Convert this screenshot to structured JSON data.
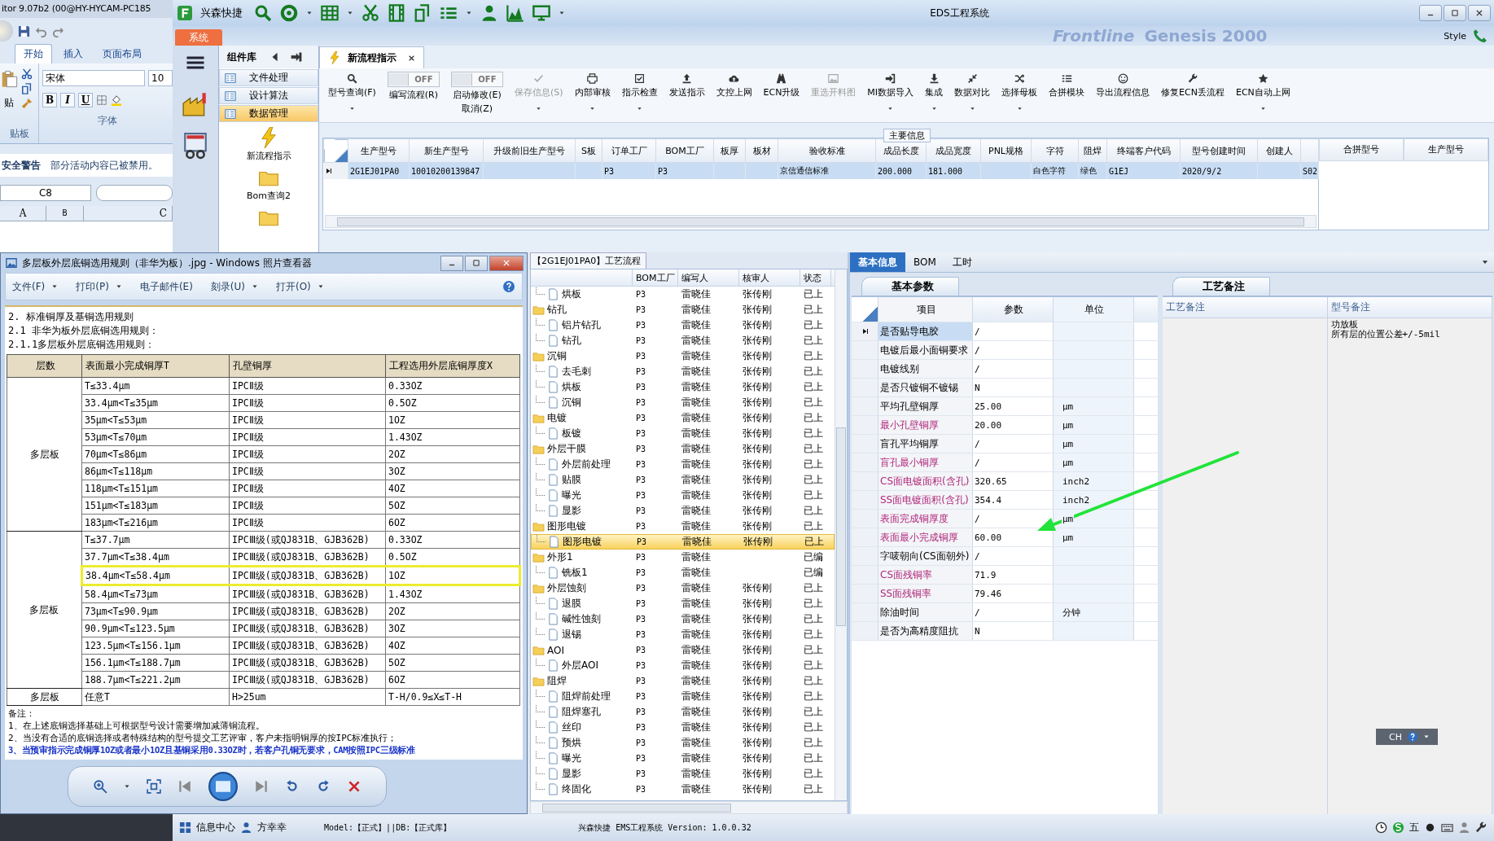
{
  "excel": {
    "window_title": "itor 9.07b2 (00@HY-HYCAM-PC185",
    "ribbon_tabs": [
      {
        "label": "开始",
        "selected": true
      },
      {
        "label": "插入",
        "selected": false
      },
      {
        "label": "页面布局",
        "selected": false
      }
    ],
    "paste_label": "贴",
    "font_name": "宋体",
    "font_size": "10",
    "format_buttons": [
      "B",
      "I",
      "U"
    ],
    "groups": [
      "贴板",
      "字体"
    ],
    "security_bar": {
      "title": "安全警告",
      "message": "部分活动内容已被禁用。"
    },
    "name_box": "C8",
    "columns": [
      "A",
      "B",
      "C"
    ]
  },
  "app": {
    "brand": "兴森快捷",
    "title": "EDS工程系统",
    "menu_tab": "系统",
    "background_texts": [
      "Frontline",
      "Genesis 2000"
    ],
    "style_menu": "Style"
  },
  "component_library": {
    "title": "组件库",
    "sections": [
      {
        "label": "文件处理",
        "selected": false
      },
      {
        "label": "设计算法",
        "selected": false
      },
      {
        "label": "数据管理",
        "selected": true
      }
    ],
    "items": [
      {
        "label": "新流程指示",
        "kind": "flash"
      },
      {
        "label": "Bom查询2",
        "kind": "folder"
      },
      {
        "kind": "folder"
      }
    ]
  },
  "document_tab": {
    "label": "新流程指示"
  },
  "toolbar": [
    {
      "label": "型号查询(F)",
      "kind": "button",
      "disabled": false,
      "dropdown": true
    },
    {
      "label": "编写流程(R)",
      "kind": "toggle",
      "state_text": "OFF",
      "on": false
    },
    {
      "label": "启动修改(E)",
      "second_line": "取消(Z)",
      "kind": "toggle",
      "state_text": "OFF",
      "on": false
    },
    {
      "label": "保存信息(S)",
      "kind": "button",
      "disabled": true,
      "dropdown": true
    },
    {
      "label": "内部审核",
      "kind": "button",
      "disabled": false,
      "dropdown": true
    },
    {
      "label": "指示检查",
      "kind": "button",
      "disabled": false,
      "dropdown": true
    },
    {
      "label": "发送指示",
      "kind": "button",
      "disabled": false,
      "dropdown": false
    },
    {
      "label": "文控上网",
      "kind": "button",
      "disabled": false,
      "dropdown": false
    },
    {
      "label": "ECN升级",
      "kind": "button",
      "disabled": false,
      "dropdown": false
    },
    {
      "label": "重选开料图",
      "kind": "button",
      "disabled": true,
      "dropdown": false
    },
    {
      "label": "MI数据导入",
      "kind": "button",
      "disabled": false,
      "dropdown": true
    },
    {
      "label": "集成",
      "kind": "button",
      "disabled": false,
      "dropdown": true
    },
    {
      "label": "数据对比",
      "kind": "button",
      "disabled": false,
      "dropdown": true
    },
    {
      "label": "选择母板",
      "kind": "button",
      "disabled": false,
      "dropdown": true
    },
    {
      "label": "合拼模块",
      "kind": "button",
      "disabled": false,
      "dropdown": false
    },
    {
      "label": "导出流程信息",
      "kind": "button",
      "disabled": false,
      "dropdown": false
    },
    {
      "label": "修复ECN丢流程",
      "kind": "button",
      "disabled": false,
      "dropdown": false
    },
    {
      "label": "ECN自动上网",
      "kind": "button",
      "disabled": false,
      "dropdown": true
    }
  ],
  "main_info": {
    "title": "主要信息",
    "columns": [
      "生产型号",
      "新生产型号",
      "升级前旧生产型号",
      "S板",
      "订单工厂",
      "BOM工厂",
      "板厚",
      "板材",
      "验收标准",
      "成品长度",
      "成品宽度",
      "PNL规格",
      "字符",
      "阻焊",
      "终端客户代码",
      "型号创建时间",
      "创建人"
    ],
    "rows": [
      {
        "selected": true,
        "cells": [
          "2G1EJ01PA0",
          "10010200139847",
          null,
          null,
          "P3",
          "P3",
          null,
          null,
          "京信通信标准",
          "200.000",
          "181.000",
          null,
          "白色字符",
          "绿色",
          "G1EJ",
          "2020/9/2",
          null,
          "S02"
        ]
      }
    ],
    "side_columns": [
      "合拼型号",
      "生产型号"
    ]
  },
  "process_flow": {
    "title": "【2G1EJ01PA0】工艺流程",
    "columns": [
      "BOM工厂",
      "编写人",
      "核审人",
      "状态"
    ],
    "rows": [
      {
        "name": "烘板",
        "kind": "step",
        "bom": "P3",
        "writer": "雷晓佳",
        "reviewer": "张传刚",
        "status": "已上",
        "selected": false
      },
      {
        "name": "钻孔",
        "kind": "folder",
        "bom": "P3",
        "writer": "雷晓佳",
        "reviewer": "张传刚",
        "status": "已上",
        "selected": false,
        "children": [
          {
            "name": "铝片钻孔",
            "kind": "step",
            "bom": "P3",
            "writer": "雷晓佳",
            "reviewer": "张传刚",
            "status": "已上",
            "selected": false
          },
          {
            "name": "钻孔",
            "kind": "step",
            "bom": "P3",
            "writer": "雷晓佳",
            "reviewer": "张传刚",
            "status": "已上",
            "selected": false
          }
        ]
      },
      {
        "name": "沉铜",
        "kind": "folder",
        "bom": "P3",
        "writer": "雷晓佳",
        "reviewer": "张传刚",
        "status": "已上",
        "selected": false,
        "children": [
          {
            "name": "去毛刺",
            "kind": "step",
            "bom": "P3",
            "writer": "雷晓佳",
            "reviewer": "张传刚",
            "status": "已上",
            "selected": false
          },
          {
            "name": "烘板",
            "kind": "step",
            "bom": "P3",
            "writer": "雷晓佳",
            "reviewer": "张传刚",
            "status": "已上",
            "selected": false
          },
          {
            "name": "沉铜",
            "kind": "step",
            "bom": "P3",
            "writer": "雷晓佳",
            "reviewer": "张传刚",
            "status": "已上",
            "selected": false
          }
        ]
      },
      {
        "name": "电镀",
        "kind": "folder",
        "bom": "P3",
        "writer": "雷晓佳",
        "reviewer": "张传刚",
        "status": "已上",
        "selected": false,
        "children": [
          {
            "name": "板镀",
            "kind": "step",
            "bom": "P3",
            "writer": "雷晓佳",
            "reviewer": "张传刚",
            "status": "已上",
            "selected": false
          }
        ]
      },
      {
        "name": "外层干膜",
        "kind": "folder",
        "bom": "P3",
        "writer": "雷晓佳",
        "reviewer": "张传刚",
        "status": "已上",
        "selected": false,
        "children": [
          {
            "name": "外层前处理",
            "kind": "step",
            "bom": "P3",
            "writer": "雷晓佳",
            "reviewer": "张传刚",
            "status": "已上",
            "selected": false
          },
          {
            "name": "贴膜",
            "kind": "step",
            "bom": "P3",
            "writer": "雷晓佳",
            "reviewer": "张传刚",
            "status": "已上",
            "selected": false
          },
          {
            "name": "曝光",
            "kind": "step",
            "bom": "P3",
            "writer": "雷晓佳",
            "reviewer": "张传刚",
            "status": "已上",
            "selected": false
          },
          {
            "name": "显影",
            "kind": "step",
            "bom": "P3",
            "writer": "雷晓佳",
            "reviewer": "张传刚",
            "status": "已上",
            "selected": false
          }
        ]
      },
      {
        "name": "图形电镀",
        "kind": "folder",
        "bom": "P3",
        "writer": "雷晓佳",
        "reviewer": "张传刚",
        "status": "已上",
        "selected": false,
        "children": [
          {
            "name": "图形电镀",
            "kind": "step",
            "bom": "P3",
            "writer": "雷晓佳",
            "reviewer": "张传刚",
            "status": "已上",
            "selected": true
          }
        ]
      },
      {
        "name": "外形1",
        "kind": "folder",
        "bom": "P3",
        "writer": "雷晓佳",
        "status": "已编",
        "selected": false,
        "children": [
          {
            "name": "铣板1",
            "kind": "step",
            "bom": "P3",
            "writer": "雷晓佳",
            "status": "已编",
            "selected": false
          }
        ]
      },
      {
        "name": "外层蚀刻",
        "kind": "folder",
        "bom": "P3",
        "writer": "雷晓佳",
        "reviewer": "张传刚",
        "status": "已上",
        "selected": false,
        "children": [
          {
            "name": "退膜",
            "kind": "step",
            "bom": "P3",
            "writer": "雷晓佳",
            "reviewer": "张传刚",
            "status": "已上",
            "selected": false
          },
          {
            "name": "碱性蚀刻",
            "kind": "step",
            "bom": "P3",
            "writer": "雷晓佳",
            "reviewer": "张传刚",
            "status": "已上",
            "selected": false
          },
          {
            "name": "退锡",
            "kind": "step",
            "bom": "P3",
            "writer": "雷晓佳",
            "reviewer": "张传刚",
            "status": "已上",
            "selected": false
          }
        ]
      },
      {
        "name": "AOI",
        "kind": "folder",
        "bom": "P3",
        "writer": "雷晓佳",
        "reviewer": "张传刚",
        "status": "已上",
        "selected": false,
        "children": [
          {
            "name": "外层AOI",
            "kind": "step",
            "bom": "P3",
            "writer": "雷晓佳",
            "reviewer": "张传刚",
            "status": "已上",
            "selected": false
          }
        ]
      },
      {
        "name": "阻焊",
        "kind": "folder",
        "bom": "P3",
        "writer": "雷晓佳",
        "reviewer": "张传刚",
        "status": "已上",
        "selected": false,
        "children": [
          {
            "name": "阻焊前处理",
            "kind": "step",
            "bom": "P3",
            "writer": "雷晓佳",
            "reviewer": "张传刚",
            "status": "已上",
            "selected": false
          },
          {
            "name": "阻焊塞孔",
            "kind": "step",
            "bom": "P3",
            "writer": "雷晓佳",
            "reviewer": "张传刚",
            "status": "已上",
            "selected": false
          },
          {
            "name": "丝印",
            "kind": "step",
            "bom": "P3",
            "writer": "雷晓佳",
            "reviewer": "张传刚",
            "status": "已上",
            "selected": false
          },
          {
            "name": "预烘",
            "kind": "step",
            "bom": "P3",
            "writer": "雷晓佳",
            "reviewer": "张传刚",
            "status": "已上",
            "selected": false
          },
          {
            "name": "曝光",
            "kind": "step",
            "bom": "P3",
            "writer": "雷晓佳",
            "reviewer": "张传刚",
            "status": "已上",
            "selected": false
          },
          {
            "name": "显影",
            "kind": "step",
            "bom": "P3",
            "writer": "雷晓佳",
            "reviewer": "张传刚",
            "status": "已上",
            "selected": false
          },
          {
            "name": "终固化",
            "kind": "step",
            "bom": "P3",
            "writer": "雷晓佳",
            "reviewer": "张传刚",
            "status": "已上",
            "selected": false
          }
        ]
      }
    ]
  },
  "details": {
    "tabs": [
      {
        "label": "基本信息",
        "selected": true
      },
      {
        "label": "BOM",
        "selected": false
      },
      {
        "label": "工时",
        "selected": false
      }
    ],
    "params_tab": "基本参数",
    "params_columns": [
      "项目",
      "参数",
      "单位"
    ],
    "params": [
      {
        "item": "是否贴导电胶",
        "value": "/",
        "highlighted": false,
        "selected": true
      },
      {
        "item": "电镀后最小面铜要求",
        "value": "/",
        "highlighted": false,
        "selected": false
      },
      {
        "item": "电镀线别",
        "value": "/",
        "highlighted": false,
        "selected": false
      },
      {
        "item": "是否只镀铜不镀锡",
        "value": "N",
        "highlighted": false,
        "selected": false
      },
      {
        "item": "平均孔壁铜厚",
        "value": "25.00",
        "unit": "μm",
        "highlighted": false,
        "selected": false
      },
      {
        "item": "最小孔壁铜厚",
        "value": "20.00",
        "unit": "μm",
        "highlighted": true,
        "selected": false
      },
      {
        "item": "盲孔平均铜厚",
        "value": "/",
        "unit": "μm",
        "highlighted": false,
        "selected": false
      },
      {
        "item": "盲孔最小铜厚",
        "value": "/",
        "unit": "μm",
        "highlighted": true,
        "selected": false
      },
      {
        "item": "CS面电镀面积(含孔)",
        "value": "320.65",
        "unit": "inch2",
        "highlighted": true,
        "selected": false
      },
      {
        "item": "SS面电镀面积(含孔)",
        "value": "354.4",
        "unit": "inch2",
        "highlighted": true,
        "selected": false
      },
      {
        "item": "表面完成铜厚度",
        "value": "/",
        "unit": "μm",
        "highlighted": true,
        "selected": false
      },
      {
        "item": "表面最小完成铜厚",
        "value": "60.00",
        "unit": "μm",
        "highlighted": true,
        "selected": false
      },
      {
        "item": "字唛朝向(CS面朝外)",
        "value": "/",
        "highlighted": false,
        "selected": false
      },
      {
        "item": "CS面残铜率",
        "value": "71.9",
        "highlighted": true,
        "selected": false
      },
      {
        "item": "SS面残铜率",
        "value": "79.46",
        "highlighted": true,
        "selected": false
      },
      {
        "item": "除油时间",
        "value": "/",
        "unit": "分钟",
        "highlighted": false,
        "selected": false
      },
      {
        "item": "是否为高精度阻抗",
        "value": "N",
        "highlighted": false,
        "selected": false
      }
    ],
    "remarks_tab": "工艺备注",
    "remarks_columns": [
      "工艺备注",
      "型号备注"
    ],
    "model_remark_lines": [
      "功放板",
      "所有层的位置公差+/-5mil"
    ]
  },
  "photo_viewer": {
    "title": "多层板外层底铜选用规则（非华为板）.jpg - Windows 照片查看器",
    "menus": [
      {
        "label": "文件(F)",
        "dropdown": true
      },
      {
        "label": "打印(P)",
        "dropdown": true
      },
      {
        "label": "电子邮件(E)",
        "dropdown": false
      },
      {
        "label": "刻录(U)",
        "dropdown": true
      },
      {
        "label": "打开(O)",
        "dropdown": true
      }
    ],
    "document": {
      "headings": [
        "2.  标准铜厚及基铜选用规则",
        "2.1  非华为板外层底铜选用规则：",
        "2.1.1多层板外层底铜选用规则："
      ],
      "columns": [
        "层数",
        "表面最小完成铜厚T",
        "孔壁铜厚",
        "工程选用外层底铜厚度X"
      ],
      "groups": [
        {
          "layer": "多层板",
          "rows": [
            {
              "t": "T≤33.4μm",
              "hole": "IPCⅡ级",
              "x": "0.33OZ",
              "highlighted": false
            },
            {
              "t": "33.4μm<T≤35μm",
              "hole": "IPCⅡ级",
              "x": "0.5OZ",
              "highlighted": false
            },
            {
              "t": "35μm<T≤53μm",
              "hole": "IPCⅡ级",
              "x": "1OZ",
              "highlighted": false
            },
            {
              "t": "53μm<T≤70μm",
              "hole": "IPCⅡ级",
              "x": "1.43OZ",
              "highlighted": false
            },
            {
              "t": "70μm<T≤86μm",
              "hole": "IPCⅡ级",
              "x": "2OZ",
              "highlighted": false
            },
            {
              "t": "86μm<T≤118μm",
              "hole": "IPCⅡ级",
              "x": "3OZ",
              "highlighted": false
            },
            {
              "t": "118μm<T≤151μm",
              "hole": "IPCⅡ级",
              "x": "4OZ",
              "highlighted": false
            },
            {
              "t": "151μm<T≤183μm",
              "hole": "IPCⅡ级",
              "x": "5OZ",
              "highlighted": false
            },
            {
              "t": "183μm<T≤216μm",
              "hole": "IPCⅡ级",
              "x": "6OZ",
              "highlighted": false
            }
          ]
        },
        {
          "layer": "多层板",
          "rows": [
            {
              "t": "T≤37.7μm",
              "hole": "IPCⅢ级(或QJ831B、GJB362B)",
              "x": "0.33OZ",
              "highlighted": false
            },
            {
              "t": "37.7μm<T≤38.4μm",
              "hole": "IPCⅢ级(或QJ831B、GJB362B)",
              "x": "0.5OZ",
              "highlighted": false
            },
            {
              "t": "38.4μm<T≤58.4μm",
              "hole": "IPCⅢ级(或QJ831B、GJB362B)",
              "x": "1OZ",
              "highlighted": true
            },
            {
              "t": "58.4μm<T≤73μm",
              "hole": "IPCⅢ级(或QJ831B、GJB362B)",
              "x": "1.43OZ",
              "highlighted": false
            },
            {
              "t": "73μm<T≤90.9μm",
              "hole": "IPCⅢ级(或QJ831B、GJB362B)",
              "x": "2OZ",
              "highlighted": false
            },
            {
              "t": "90.9μm<T≤123.5μm",
              "hole": "IPCⅢ级(或QJ831B、GJB362B)",
              "x": "3OZ",
              "highlighted": false
            },
            {
              "t": "123.5μm<T≤156.1μm",
              "hole": "IPCⅢ级(或QJ831B、GJB362B)",
              "x": "4OZ",
              "highlighted": false
            },
            {
              "t": "156.1μm<T≤188.7μm",
              "hole": "IPCⅢ级(或QJ831B、GJB362B)",
              "x": "5OZ",
              "highlighted": false
            },
            {
              "t": "188.7μm<T≤221.2μm",
              "hole": "IPCⅢ级(或QJ831B、GJB362B)",
              "x": "6OZ",
              "highlighted": false
            }
          ]
        },
        {
          "layer": "多层板",
          "rows": [
            {
              "t": "任意T",
              "hole": "H>25um",
              "x": "T-H/0.9≤X≤T-H",
              "highlighted": false
            }
          ]
        }
      ],
      "notes": [
        {
          "text": "备注：",
          "emphasis": false
        },
        {
          "text": "1、在上述底铜选择基础上可根据型号设计需要增加减薄铜流程。",
          "emphasis": false
        },
        {
          "text": "2、当没有合适的底铜选择或者特殊结构的型号提交工艺评审，客户未指明铜厚的按IPC标准执行；",
          "emphasis": false
        },
        {
          "text": "3、当预审指示完成铜厚1OZ或者最小1OZ且基铜采用0.33OZ时，若客户孔铜无要求，CAM按照IPC三级标准",
          "emphasis": true
        }
      ]
    }
  },
  "status_bar": {
    "info_center": "信息中心",
    "user": "方幸幸",
    "model": "Model:【正式】||DB:【正式库】",
    "version": "兴森快捷 EMS工程系统 Version: 1.0.0.32",
    "ime": "五"
  },
  "language_bar": {
    "label": "CH"
  }
}
